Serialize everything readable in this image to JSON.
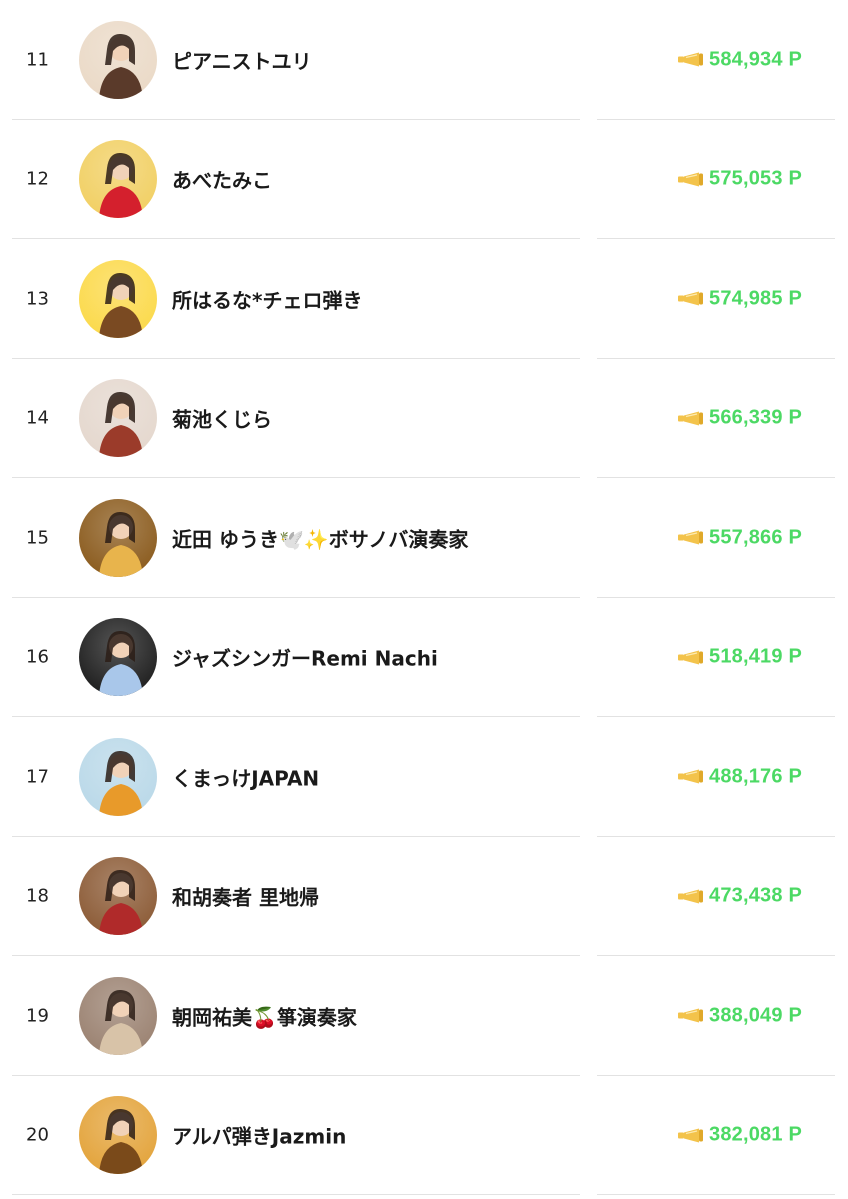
{
  "colors": {
    "points": "#4cd964",
    "megaphone": "#f3c34b",
    "divider": "#e2e2e2"
  },
  "rows": [
    {
      "rank": "11",
      "name": "ピアニストユリ",
      "points": "584,934 P",
      "icon": "megaphone-icon",
      "avatar": {
        "bg": "#ead9c6",
        "fg": "#5a3a2a"
      }
    },
    {
      "rank": "12",
      "name": "あべたみこ",
      "points": "575,053 P",
      "icon": "megaphone-icon",
      "avatar": {
        "bg": "#f1cf62",
        "fg": "#d4202d"
      }
    },
    {
      "rank": "13",
      "name": "所はるな*チェロ弾き",
      "points": "574,985 P",
      "icon": "megaphone-icon",
      "avatar": {
        "bg": "#fbd949",
        "fg": "#7a4a22"
      }
    },
    {
      "rank": "14",
      "name": "菊池くじら",
      "points": "566,339 P",
      "icon": "megaphone-icon",
      "avatar": {
        "bg": "#e4d7cd",
        "fg": "#9b3b2a"
      }
    },
    {
      "rank": "15",
      "name": "近田 ゆうき🕊️✨ボサノバ演奏家",
      "points": "557,866 P",
      "icon": "megaphone-icon",
      "avatar": {
        "bg": "#8a5a1c",
        "fg": "#e8b44c"
      }
    },
    {
      "rank": "16",
      "name": "ジャズシンガーRemi Nachi",
      "points": "518,419 P",
      "icon": "megaphone-icon",
      "avatar": {
        "bg": "#1c1c1c",
        "fg": "#a9c7ea"
      }
    },
    {
      "rank": "17",
      "name": "くまっけJAPAN",
      "points": "488,176 P",
      "icon": "megaphone-icon",
      "avatar": {
        "bg": "#b9d8e8",
        "fg": "#e89a2a"
      }
    },
    {
      "rank": "18",
      "name": "和胡奏者 里地帰",
      "points": "473,438 P",
      "icon": "megaphone-icon",
      "avatar": {
        "bg": "#8b5a35",
        "fg": "#b02a2a"
      }
    },
    {
      "rank": "19",
      "name": "朝岡祐美🍒箏演奏家",
      "points": "388,049 P",
      "icon": "megaphone-icon",
      "avatar": {
        "bg": "#9a8170",
        "fg": "#d8c3a8"
      }
    },
    {
      "rank": "20",
      "name": "アルパ弾きJazmin",
      "points": "382,081 P",
      "icon": "megaphone-icon",
      "avatar": {
        "bg": "#e3a33a",
        "fg": "#7a4a1a"
      }
    }
  ]
}
